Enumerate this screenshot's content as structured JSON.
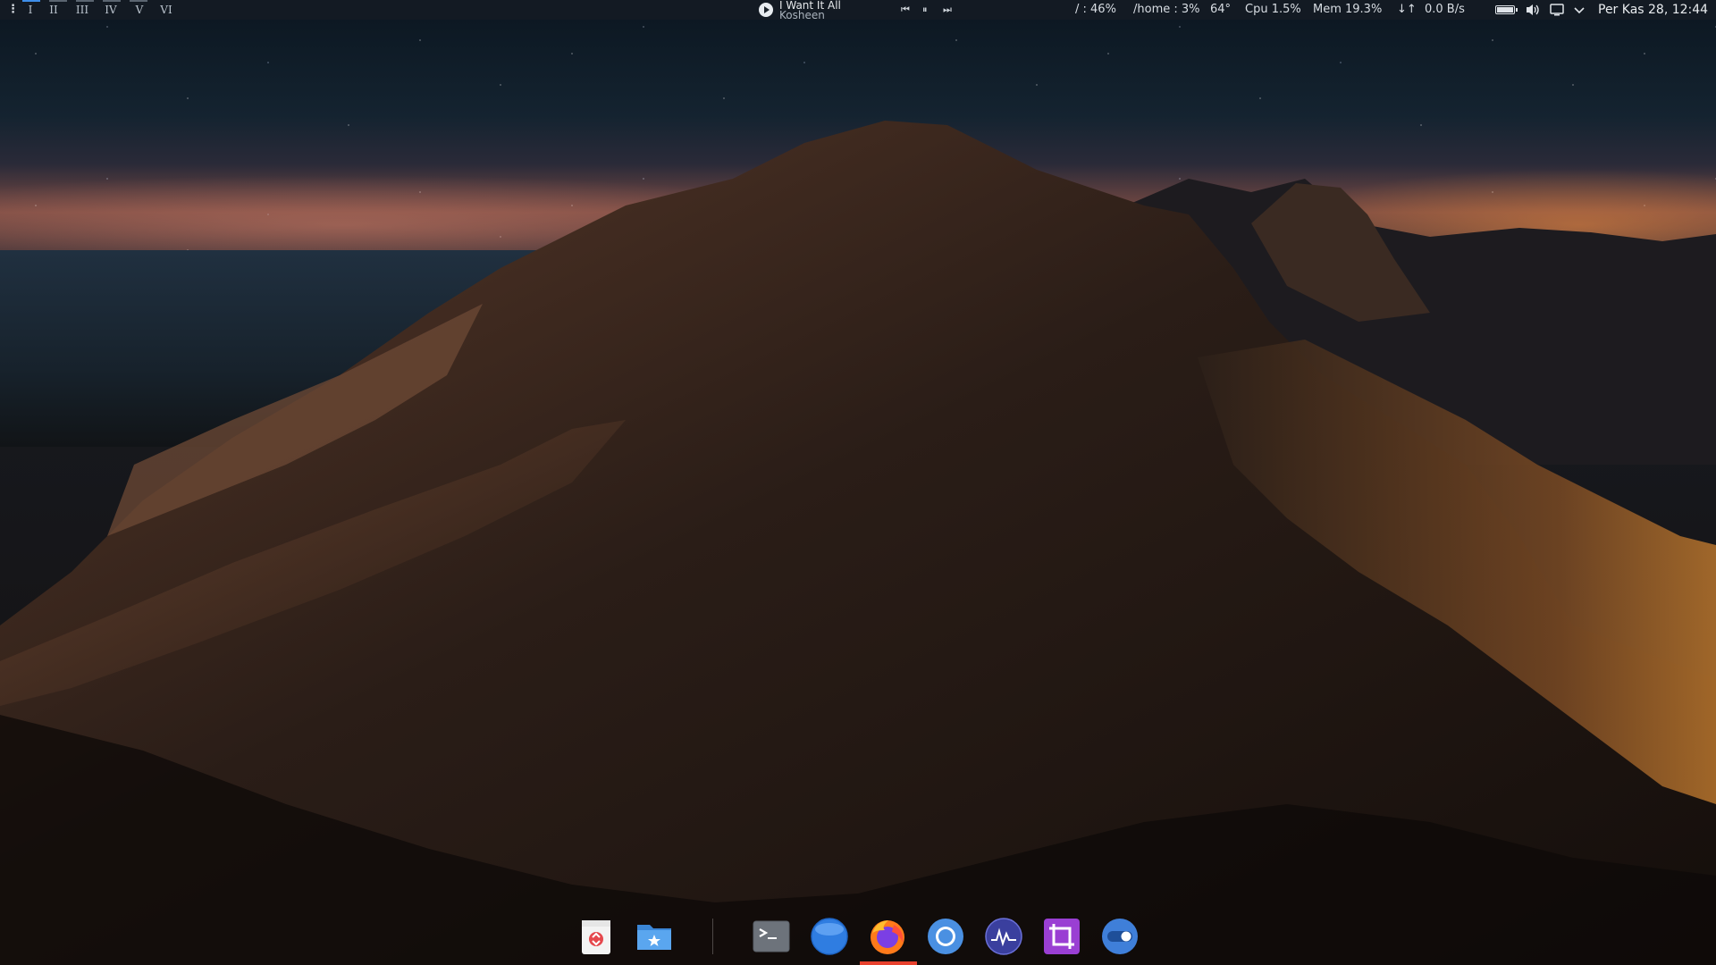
{
  "top_panel": {
    "menu_glyph": "⋮",
    "workspaces": [
      {
        "label": "I",
        "active": true
      },
      {
        "label": "II",
        "active": false
      },
      {
        "label": "III",
        "active": false
      },
      {
        "label": "IV",
        "active": false
      },
      {
        "label": "V",
        "active": false
      },
      {
        "label": "VI",
        "active": false
      }
    ],
    "media": {
      "title": "I Want It All",
      "artist": "Kosheen",
      "prev_glyph": "⏮",
      "pause_glyph": "⏸",
      "next_glyph": "⏭"
    },
    "stats": {
      "root_disk": "/ : 46%",
      "home_disk": "/home : 3%",
      "temperature": "64°",
      "cpu": "Cpu 1.5%",
      "memory": "Mem 19.3%",
      "net_arrows": "↓↑",
      "net_rate": "0.0 B/s"
    },
    "clock": "Per Kas 28, 12:44"
  },
  "dock": {
    "items": [
      {
        "name": "trash",
        "icon": "trash-icon"
      },
      {
        "name": "files",
        "icon": "folder-icon"
      },
      {
        "name": "terminal",
        "icon": "terminal-icon"
      },
      {
        "name": "browser",
        "icon": "globe-icon"
      },
      {
        "name": "firefox",
        "icon": "firefox-icon"
      },
      {
        "name": "chromium",
        "icon": "chromium-icon"
      },
      {
        "name": "system-monitor",
        "icon": "monitor-wave-icon"
      },
      {
        "name": "screenshot",
        "icon": "crop-icon"
      },
      {
        "name": "settings",
        "icon": "toggle-icon"
      }
    ],
    "active_item": "firefox"
  },
  "colors": {
    "accent": "#3e8ee9",
    "active_indicator": "#e8412d"
  }
}
